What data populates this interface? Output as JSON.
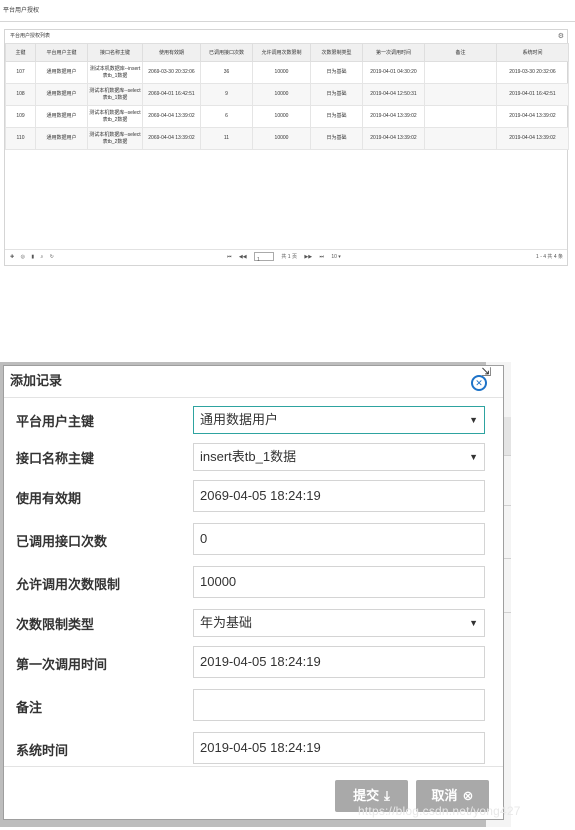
{
  "page_title": "平台用户授权",
  "panel": {
    "title": "平台用户授权列表",
    "gear_icon": "gear-icon",
    "columns": [
      "主键",
      "平台用户主键",
      "接口名称主键",
      "使用有效期",
      "已调用接口次数",
      "允许调用次数限制",
      "次数限制类型",
      "第一次调用时间",
      "备注",
      "系统时间"
    ],
    "rows": [
      [
        "107",
        "通用数据用户",
        "测试本机数据库--insert表tb_1数据",
        "2069-03-30 20:32:06",
        "36",
        "10000",
        "日为基础",
        "2019-04-01 04:30:20",
        "",
        "2019-03-30 20:32:06"
      ],
      [
        "108",
        "通用数据用户",
        "测试本机数据库--select表tb_1数据",
        "2069-04-01 16:42:51",
        "9",
        "10000",
        "日为基础",
        "2019-04-04 12:50:31",
        "",
        "2019-04-01 16:42:51"
      ],
      [
        "109",
        "通用数据用户",
        "测试本机数据库--select表tb_2数据",
        "2069-04-04 13:39:02",
        "6",
        "10000",
        "日为基础",
        "2019-04-04 13:39:02",
        "",
        "2019-04-04 13:39:02"
      ],
      [
        "110",
        "通用数据用户",
        "测试本机数据库--select表tb_2数据",
        "2069-04-04 13:39:02",
        "11",
        "10000",
        "日为基础",
        "2019-04-04 13:39:02",
        "",
        "2019-04-04 13:39:02"
      ]
    ],
    "pager": {
      "tools": [
        "+",
        "⊙",
        "🗑",
        "🔍",
        "↻"
      ],
      "first": "⏮",
      "prev": "⏪",
      "page_value": "1",
      "page_of": "共 1 页",
      "next": "⏩",
      "last": "⏭",
      "page_size": "10 ▾",
      "summary": "1 - 4   共 4 条"
    }
  },
  "background": {
    "header_fragment": "时",
    "cell_fragments": [
      "4:",
      "2:",
      "3:",
      "3:"
    ],
    "left_fragments": [
      "0",
      "5",
      "0",
      "0"
    ]
  },
  "dialog": {
    "title": "添加记录",
    "close_icon": "close-circle-icon",
    "resize_icon": "resize-icon",
    "fields": [
      {
        "label": "平台用户主键",
        "value": "通用数据用户",
        "type": "select"
      },
      {
        "label": "接口名称主键",
        "value": "insert表tb_1数据",
        "type": "select"
      },
      {
        "label": "使用有效期",
        "value": "2069-04-05 18:24:19",
        "type": "text"
      },
      {
        "label": "已调用接口次数",
        "value": "0",
        "type": "text"
      },
      {
        "label": "允许调用次数限制",
        "value": "10000",
        "type": "text"
      },
      {
        "label": "次数限制类型",
        "value": "年为基础",
        "type": "select"
      },
      {
        "label": "第一次调用时间",
        "value": "2019-04-05 18:24:19",
        "type": "text"
      },
      {
        "label": "备注",
        "value": "",
        "type": "text"
      },
      {
        "label": "系统时间",
        "value": "2019-04-05 18:24:19",
        "type": "text"
      }
    ],
    "submit_label": "提交",
    "submit_icon": "download-icon",
    "cancel_label": "取消",
    "cancel_icon": "close-circle-icon"
  },
  "watermark": "https://blog.csdn.net/yong427"
}
